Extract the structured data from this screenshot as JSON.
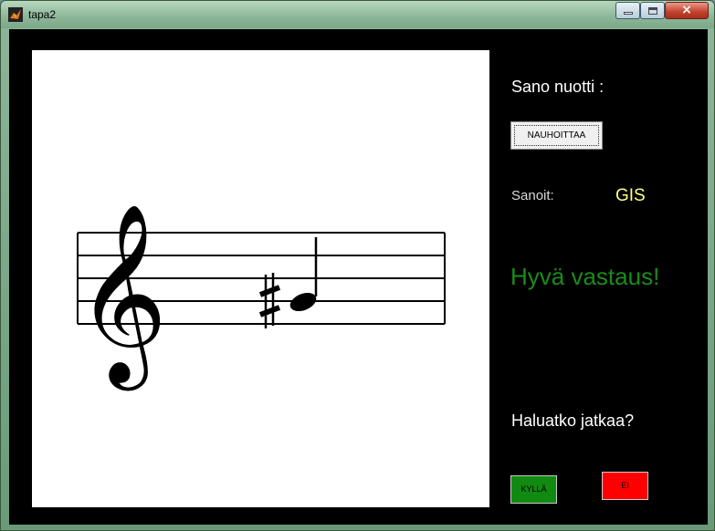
{
  "window": {
    "title": "tapa2",
    "close_glyph": "×",
    "app_icon": "matlab-icon"
  },
  "staff": {
    "clef": "treble-clef",
    "accidental": "sharp",
    "note": "G#",
    "note_value": "quarter"
  },
  "panel": {
    "prompt_label": "Sano nuotti :",
    "record_button": "NAUHOITTAA",
    "said_label": "Sanoit:",
    "said_value": "GIS",
    "feedback": "Hyvä vastaus!",
    "continue_question": "Haluatko jatkaa?",
    "yes_button": "KYLLÄ",
    "no_button": "EI"
  },
  "colors": {
    "yes_button": "#118a11",
    "no_button": "#ff0000",
    "feedback": "#1a8c1a",
    "said_value": "#ffff88"
  }
}
